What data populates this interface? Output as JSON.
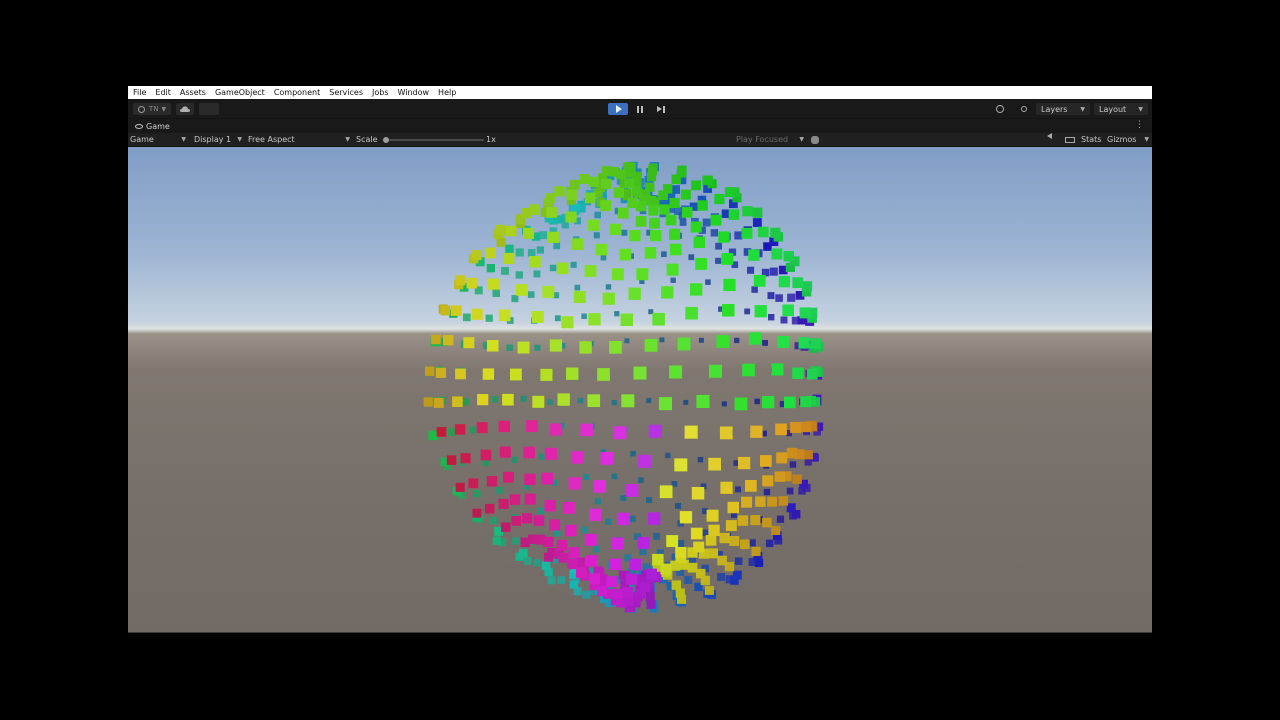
{
  "menubar": {
    "items": [
      "File",
      "Edit",
      "Assets",
      "GameObject",
      "Component",
      "Services",
      "Jobs",
      "Window",
      "Help"
    ]
  },
  "toolbar": {
    "account_label": "TN",
    "play_state": "playing",
    "right": {
      "layers_label": "Layers",
      "layout_label": "Layout"
    },
    "icons": {
      "account": "account-icon",
      "cloud": "cloud-icon",
      "play": "play-icon",
      "pause": "pause-icon",
      "step": "step-icon",
      "history": "history-icon",
      "search": "search-icon"
    },
    "accent_color": "#3b6fbf"
  },
  "tab": {
    "label": "Game",
    "more": "⋮"
  },
  "gamebar": {
    "mode": "Game",
    "display": "Display 1",
    "aspect": "Free Aspect",
    "scale_label": "Scale",
    "scale_value": "1x",
    "play_focused": "Play Focused",
    "stats": "Stats",
    "gizmos": "Gizmos"
  },
  "viewport": {
    "content": "sphere-of-colored-cubes",
    "sky_color": "#8fa9cd",
    "ground_color": "#76706a"
  }
}
